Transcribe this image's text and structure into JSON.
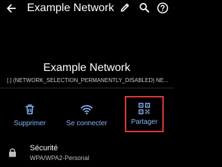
{
  "app_bar": {
    "title": "Example Network",
    "icons": [
      "back-arrow-icon",
      "edit-pencil-icon",
      "search-icon",
      "help-icon"
    ]
  },
  "network": {
    "name": "Example Network",
    "status": "[.] (NETWORK_SELECTION_PERMANENTLY_DISABLED) NE..."
  },
  "actions": [
    {
      "label": "Supprimer",
      "icon": "trash-icon"
    },
    {
      "label": "Se connecter",
      "icon": "wifi-icon"
    },
    {
      "label": "Partager",
      "icon": "qr-code-icon",
      "highlighted": true
    }
  ],
  "security": {
    "title": "Sécurité",
    "value": "WPA/WPA2-Personal",
    "icon": "lock-icon"
  },
  "colors": {
    "background": "#000000",
    "accent": "#8ab4f8",
    "highlight_border": "#e53935",
    "text_primary": "#ffffff",
    "text_secondary": "#bdbdbd"
  }
}
